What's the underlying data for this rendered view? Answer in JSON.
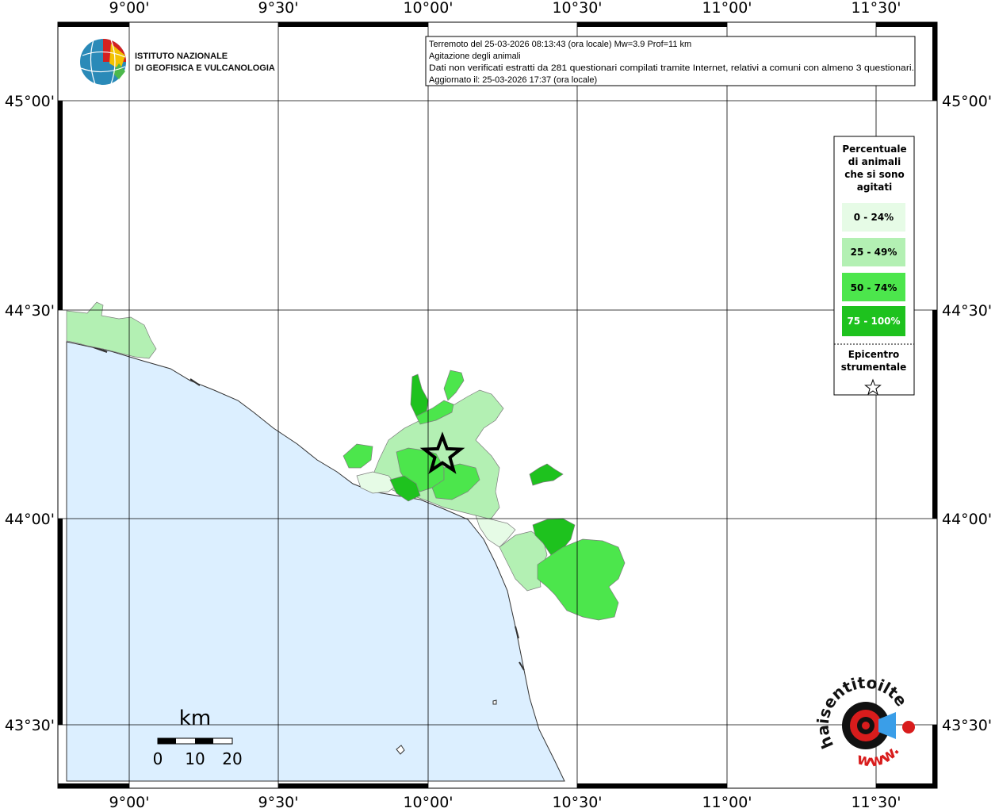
{
  "map": {
    "lon_ticks": [
      "9°00'",
      "9°30'",
      "10°00'",
      "10°30'",
      "11°00'",
      "11°30'"
    ],
    "lat_ticks": [
      "45°00'",
      "44°30'",
      "44°00'",
      "43°30'"
    ]
  },
  "info_box": {
    "line1": "Terremoto del 25-03-2026 08:13:43 (ora locale) Mw=3.9 Prof=11 km",
    "line2": "Agitazione degli animali",
    "line3": "Dati non verificati estratti da 281 questionari compilati tramite Internet, relativi a comuni con almeno 3 questionari.",
    "line4": "Aggiornato il: 25-03-2026 17:37 (ora locale)"
  },
  "logo": {
    "line1": "ISTITUTO NAZIONALE",
    "line2": "DI GEOFISICA E VULCANOLOGIA"
  },
  "legend": {
    "title_lines": [
      "Percentuale",
      "di animali",
      "che si sono",
      "agitati"
    ],
    "classes": [
      {
        "label": "0 - 24%",
        "color": "#e6fbe6",
        "text_color": "#000000"
      },
      {
        "label": "25 - 49%",
        "color": "#b3f0b3",
        "text_color": "#000000"
      },
      {
        "label": "50 - 74%",
        "color": "#4ce64c",
        "text_color": "#000000"
      },
      {
        "label": "75 - 100%",
        "color": "#1ec21e",
        "text_color": "#ffffff"
      }
    ],
    "epicenter_lines": [
      "Epicentro",
      "strumentale"
    ]
  },
  "scale_bar": {
    "title": "km",
    "labels": [
      "0",
      "10",
      "20"
    ]
  },
  "badge": {
    "text": "haisentitoilterremoto.it",
    "url_text": "www."
  },
  "colors": {
    "sea": "#dcefff",
    "land": "#ffffff",
    "grid": "#000000",
    "class_0_24": "#e6fbe6",
    "class_25_49": "#b3f0b3",
    "class_50_74": "#4ce64c",
    "class_75_100": "#1ec21e"
  }
}
